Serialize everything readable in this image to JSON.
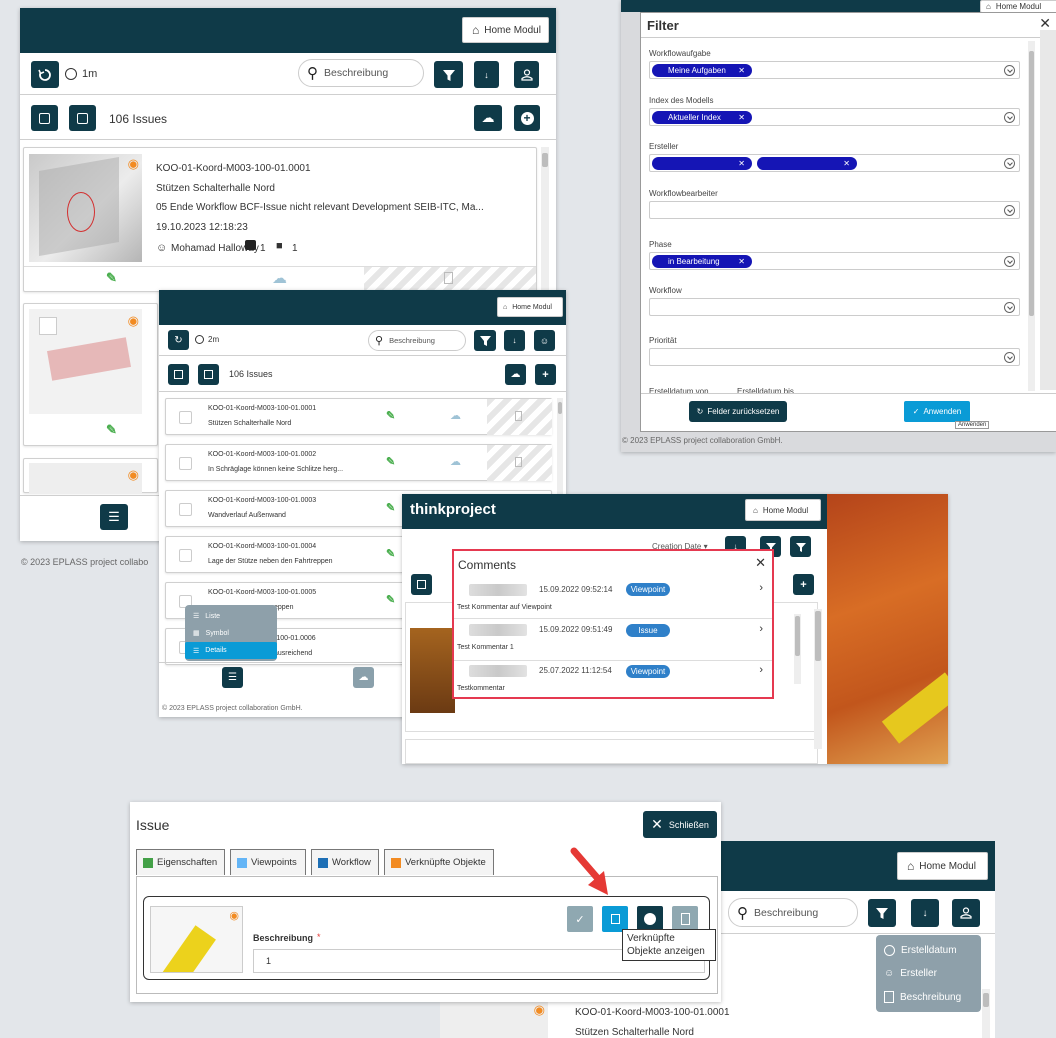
{
  "home_label": "Home Modul",
  "search_placeholder": "Beschreibung",
  "p1": {
    "time": "1m",
    "issue_count": "106 Issues",
    "card": {
      "title": "KOO-01-Koord-M003-100-01.0001",
      "subtitle": "Stützen Schalterhalle Nord",
      "workflow": "05 Ende Workflow BCF-Issue nicht relevant Development SEIB-ITC, Ma...",
      "date": "19.10.2023 12:18:23",
      "user": "Mohamad Halloway",
      "photo_count": "1",
      "comment_count": "1"
    },
    "footer": "© 2023 EPLASS project collabo"
  },
  "p2": {
    "time": "2m",
    "issue_count": "106 Issues",
    "rows": [
      {
        "id": "KOO-01-Koord-M003-100-01.0001",
        "desc": "Stützen Schalterhalle Nord"
      },
      {
        "id": "KOO-01-Koord-M003-100-01.0002",
        "desc": "In Schräglage können keine Schlitze herg..."
      },
      {
        "id": "KOO-01-Koord-M003-100-01.0003",
        "desc": "Wandverlauf Außenwand"
      },
      {
        "id": "KOO-01-Koord-M003-100-01.0004",
        "desc": "Lage der Stütze neben den Fahrtreppen"
      },
      {
        "id": "KOO-01-Koord-M003-100-01.0005",
        "desc": "eppen"
      },
      {
        "id": "-100-01.0006",
        "desc": "ausreichend"
      }
    ],
    "view_menu": [
      "Liste",
      "Symbol",
      "Details"
    ],
    "footer": "© 2023 EPLASS project collaboration GmbH."
  },
  "filter": {
    "title": "Filter",
    "top_home": "Home Modul",
    "fields": [
      {
        "label": "Workflowaufgabe",
        "chips": [
          "Meine Aufgaben"
        ]
      },
      {
        "label": "Index des Modells",
        "chips": [
          "Aktueller Index"
        ]
      },
      {
        "label": "Ersteller",
        "chips": [
          "",
          ""
        ]
      },
      {
        "label": "Workflowbearbeiter",
        "chips": []
      },
      {
        "label": "Phase",
        "chips": [
          "in Bearbeitung"
        ]
      },
      {
        "label": "Workflow",
        "chips": []
      },
      {
        "label": "Priorität",
        "chips": []
      }
    ],
    "date_from": "Erstelldatum von",
    "date_to": "Erstelldatum bis",
    "reset_label": "Felder zurücksetzen",
    "apply_label": "Anwenden",
    "apply_tooltip": "Anwenden",
    "footer": "© 2023 EPLASS project collaboration GmbH."
  },
  "comments": {
    "brand": "thinkproject",
    "home": "Home Modul",
    "sort_label": "Creation Date",
    "title": "Comments",
    "items": [
      {
        "date": "15.09.2022 09:52:14",
        "badge": "Viewpoint",
        "text": "Test Kommentar auf Viewpoint"
      },
      {
        "date": "15.09.2022 09:51:49",
        "badge": "Issue",
        "text": "Test Kommentar 1"
      },
      {
        "date": "25.07.2022 11:12:54",
        "badge": "Viewpoint",
        "text": "Testkommentar"
      }
    ]
  },
  "issue": {
    "title": "Issue",
    "close_label": "Schließen",
    "tabs": [
      "Eigenschaften",
      "Viewpoints",
      "Workflow",
      "Verknüpfte Objekte"
    ],
    "field_label": "Beschreibung",
    "required_mark": "*",
    "field_value": "1",
    "tooltip_line1": "Verknüpfte",
    "tooltip_line2": "Objekte anzeigen"
  },
  "p5": {
    "home": "Home Modul",
    "search": "Beschreibung",
    "sort_menu": [
      "Erstelldatum",
      "Ersteller",
      "Beschreibung"
    ],
    "card_title": "KOO-01-Koord-M003-100-01.0001",
    "card_subtitle": "Stützen Schalterhalle Nord"
  },
  "colors": {
    "header": "#0f3a48",
    "accent": "#0a9bd6",
    "red": "#e53935",
    "chip": "#1515b5",
    "badge": "#2f80c9"
  }
}
